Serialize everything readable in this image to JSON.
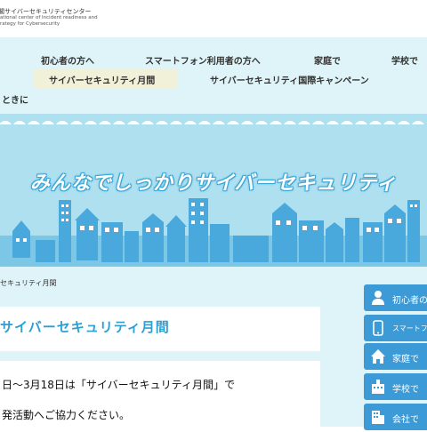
{
  "header": {
    "logo_line1": "閣サイバーセキュリティセンター",
    "logo_line2": "ational center of Incident readiness and",
    "logo_line3": "rategy for Cybersecurity"
  },
  "nav": {
    "items": [
      {
        "label": "初心者の方へ"
      },
      {
        "label": "スマートフォン利用者の方へ"
      },
      {
        "label": "家庭で"
      },
      {
        "label": "学校で"
      },
      {
        "label": "サイバーセキュリティ月間"
      },
      {
        "label": "サイバーセキュリティ国際キャンペーン"
      },
      {
        "label": "ときに"
      }
    ]
  },
  "hero": {
    "title": "みんなでしっかりサイバーセキュリティ"
  },
  "breadcrumb": "セキュリティ月間",
  "page_title": "サイバーセキュリティ月間",
  "body": {
    "line1": "日～3月18日は「サイバーセキュリティ月間」で",
    "line2": "発活動へご協力ください。"
  },
  "sidebar": {
    "buttons": [
      {
        "label": "初心者の",
        "icon": "person-icon"
      },
      {
        "label": "スマートフォ",
        "icon": "smartphone-icon"
      },
      {
        "label": "家庭で",
        "icon": "house-icon"
      },
      {
        "label": "学校で",
        "icon": "school-icon"
      },
      {
        "label": "会社で",
        "icon": "office-building-icon"
      }
    ]
  },
  "colors": {
    "accent": "#2aa0d4",
    "nav_bg": "#dff4f8",
    "hero_bg": "#aee0f0",
    "sidebar_button": "#3c9ad6",
    "active_tab": "#f1f0d8"
  }
}
